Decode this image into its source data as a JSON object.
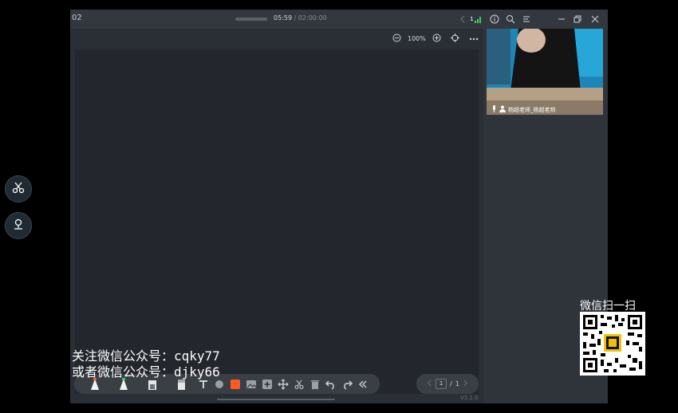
{
  "left_tools": [
    {
      "icon": "scissors-icon"
    },
    {
      "icon": "pin-icon"
    }
  ],
  "titlebar": {
    "title": "02",
    "time_current": "05:59",
    "time_separator": " / ",
    "time_total": "02:00:00",
    "signal_label": "1"
  },
  "canvas": {
    "zoom": "100%"
  },
  "pager": {
    "current": "1",
    "separator": "/",
    "total": "1"
  },
  "version": "V3.1.0",
  "video": {
    "teacher_name": "杨超老师_杨超老师"
  },
  "watermark": {
    "line1": "关注微信公众号：cqky77",
    "line2": "或者微信公众号：djky66",
    "qr_label": "微信扫一扫"
  },
  "colors": {
    "accent_orange": "#ff5a1f",
    "signal_green": "#3ecf5a"
  }
}
